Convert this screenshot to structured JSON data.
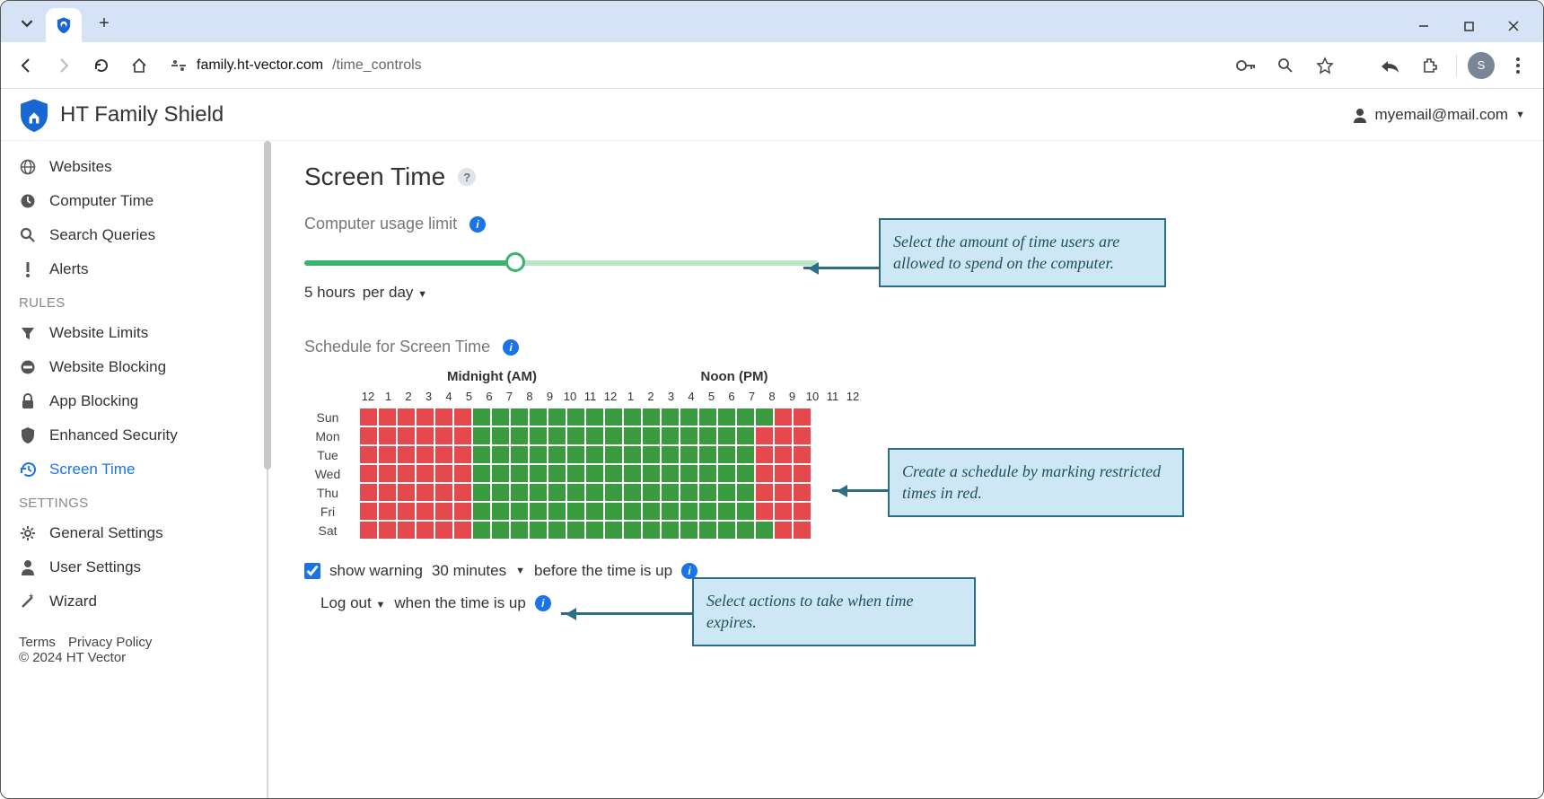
{
  "browser": {
    "url_host": "family.ht-vector.com",
    "url_path": "/time_controls",
    "avatar_letter": "S"
  },
  "app": {
    "title": "HT Family Shield",
    "user_email": "myemail@mail.com"
  },
  "sidebar": {
    "items_top": [
      {
        "label": "Websites",
        "icon": "globe"
      },
      {
        "label": "Computer Time",
        "icon": "clock"
      },
      {
        "label": "Search Queries",
        "icon": "search"
      },
      {
        "label": "Alerts",
        "icon": "alert"
      }
    ],
    "head_rules": "RULES",
    "items_rules": [
      {
        "label": "Website Limits",
        "icon": "filter"
      },
      {
        "label": "Website Blocking",
        "icon": "block"
      },
      {
        "label": "App Blocking",
        "icon": "lock"
      },
      {
        "label": "Enhanced Security",
        "icon": "shield"
      },
      {
        "label": "Screen Time",
        "icon": "history",
        "active": true
      }
    ],
    "head_settings": "SETTINGS",
    "items_settings": [
      {
        "label": "General Settings",
        "icon": "gear"
      },
      {
        "label": "User Settings",
        "icon": "user"
      },
      {
        "label": "Wizard",
        "icon": "wand"
      }
    ],
    "footer": {
      "terms": "Terms",
      "privacy": "Privacy Policy",
      "copyright": "© 2024 HT Vector"
    }
  },
  "page": {
    "title": "Screen Time",
    "usage_label": "Computer usage limit",
    "slider_fill_percent": 41,
    "usage_value": "5 hours",
    "usage_period": "per day",
    "schedule_label": "Schedule for Screen Time",
    "schedule_am": "Midnight (AM)",
    "schedule_pm": "Noon (PM)",
    "hours": [
      "12",
      "1",
      "2",
      "3",
      "4",
      "5",
      "6",
      "7",
      "8",
      "9",
      "10",
      "11",
      "12",
      "1",
      "2",
      "3",
      "4",
      "5",
      "6",
      "7",
      "8",
      "9",
      "10",
      "11",
      "12"
    ],
    "days": [
      "Sun",
      "Mon",
      "Tue",
      "Wed",
      "Thu",
      "Fri",
      "Sat"
    ],
    "schedule_blocked_ranges": {
      "Sun": [
        [
          0,
          6
        ],
        [
          22,
          24
        ]
      ],
      "Mon": [
        [
          0,
          6
        ],
        [
          21,
          24
        ]
      ],
      "Tue": [
        [
          0,
          6
        ],
        [
          21,
          24
        ]
      ],
      "Wed": [
        [
          0,
          6
        ],
        [
          21,
          24
        ]
      ],
      "Thu": [
        [
          0,
          6
        ],
        [
          21,
          24
        ]
      ],
      "Fri": [
        [
          0,
          6
        ],
        [
          21,
          24
        ]
      ],
      "Sat": [
        [
          0,
          6
        ],
        [
          22,
          24
        ]
      ]
    },
    "warning_checked": true,
    "warning_prefix": "show warning",
    "warning_amount": "30 minutes",
    "warning_suffix": "before the time is up",
    "action_value": "Log out",
    "action_suffix": "when the time is up"
  },
  "callouts": {
    "c1": "Select the amount of time users are allowed to spend on the computer.",
    "c2": "Create a schedule by marking restricted times in red.",
    "c3": "Select actions to take when time expires."
  }
}
